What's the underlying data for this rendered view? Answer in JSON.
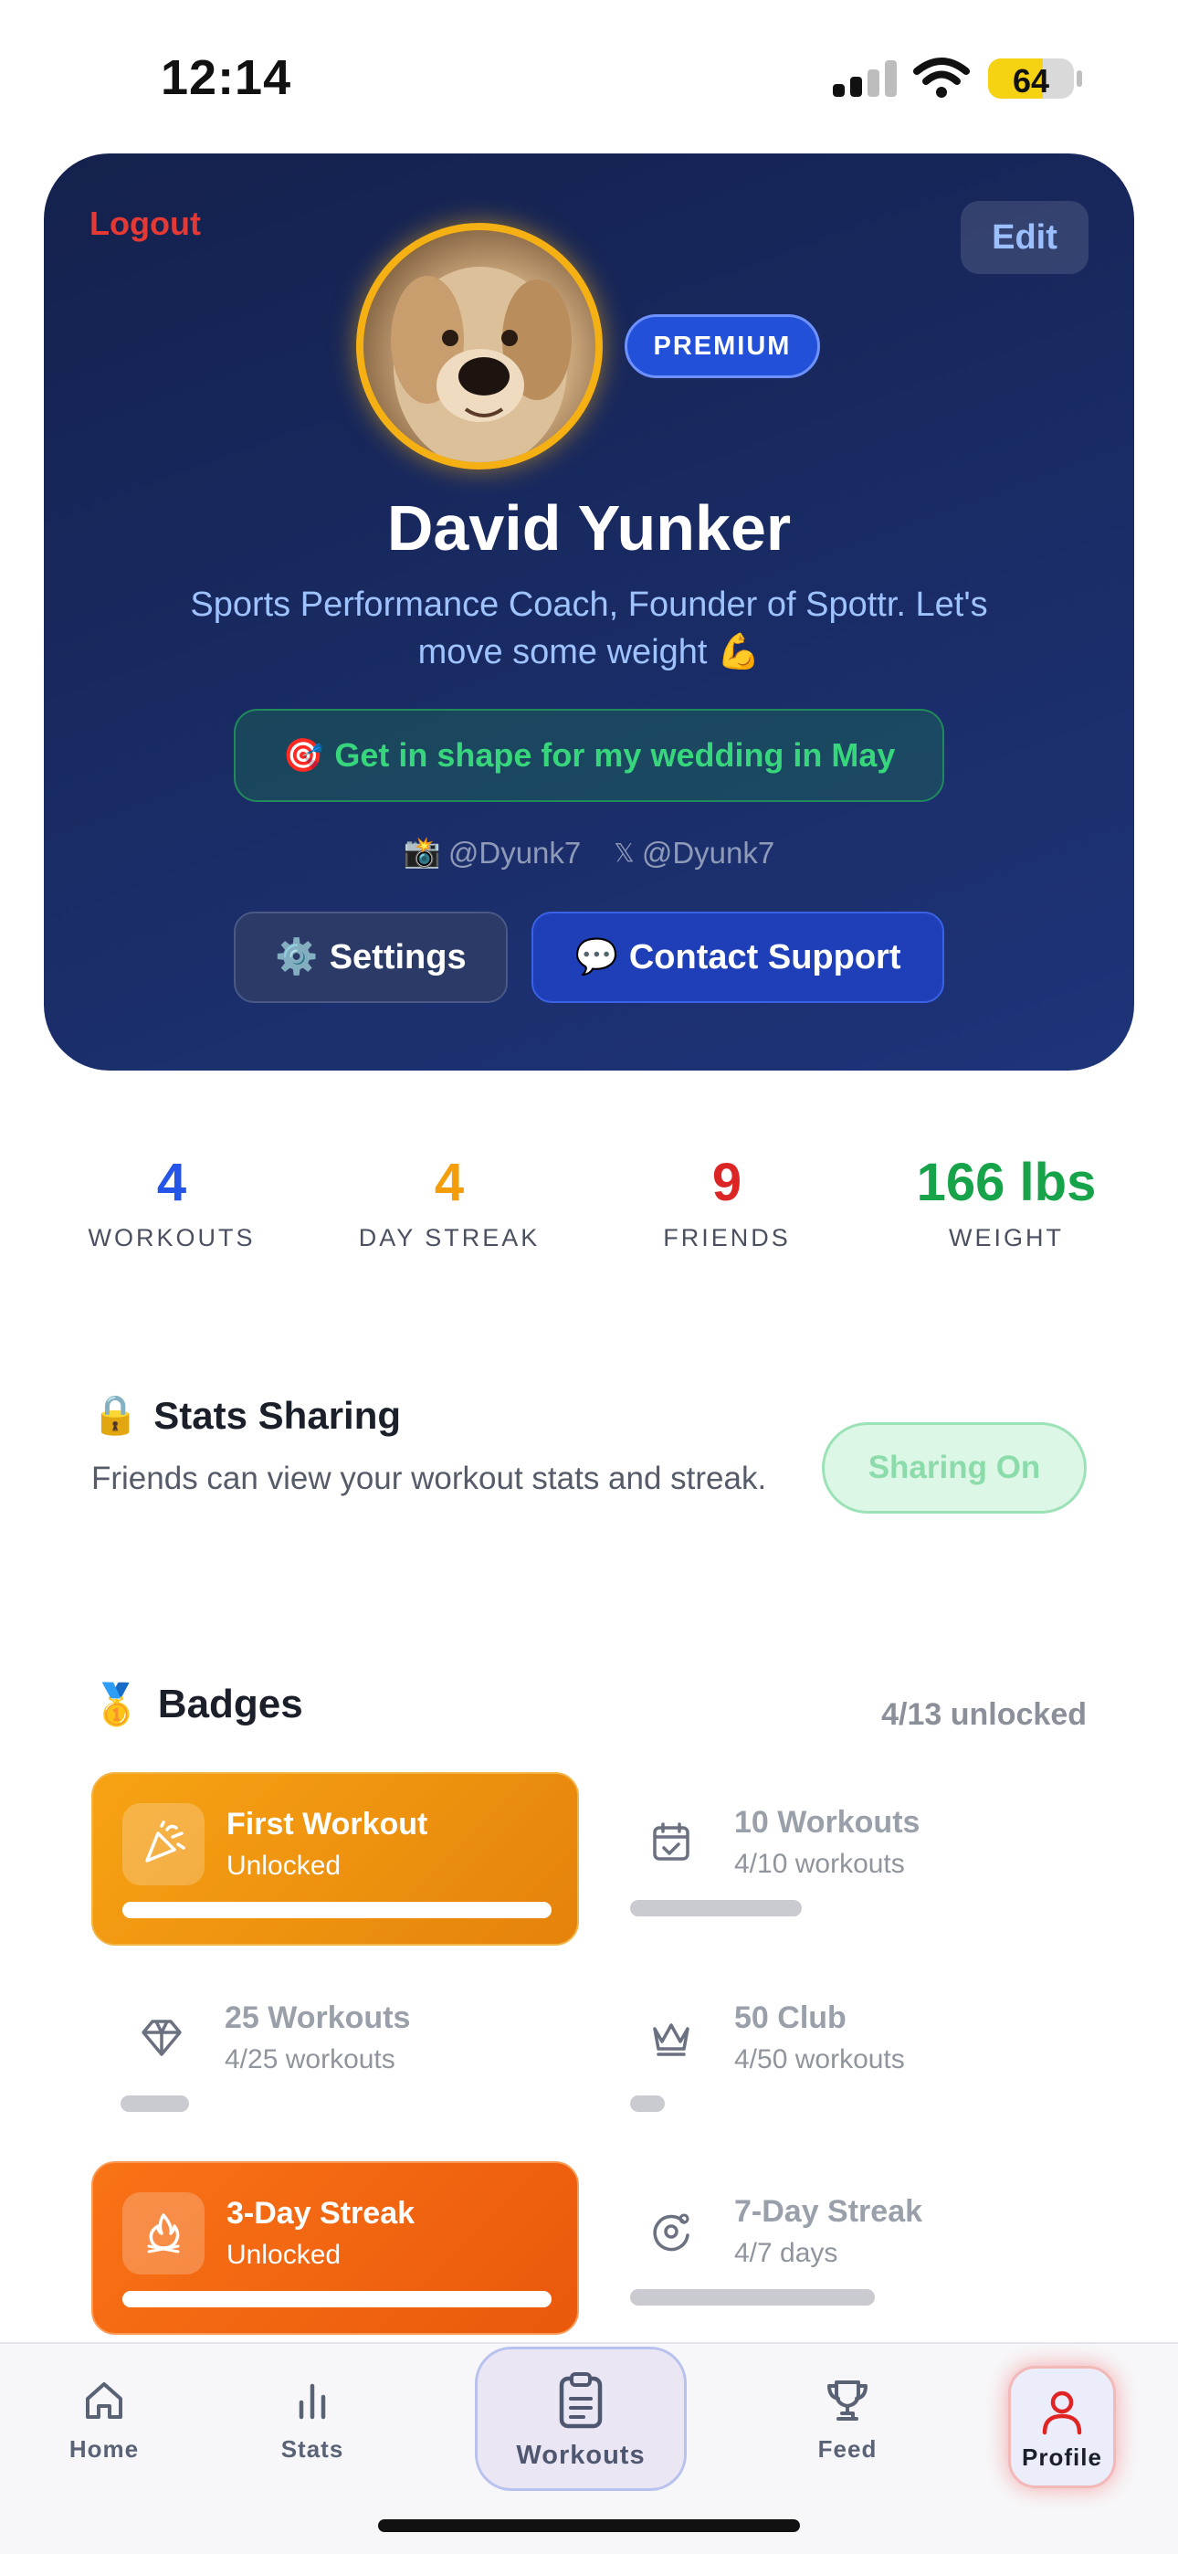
{
  "status_bar": {
    "time": "12:14",
    "battery": "64",
    "battery_level": 0.64
  },
  "profile": {
    "logout_label": "Logout",
    "edit_label": "Edit",
    "premium_badge": "PREMIUM",
    "name": "David Yunker",
    "bio": "Sports Performance Coach, Founder of Spottr. Let's move some weight 💪",
    "goal_icon": "🎯",
    "goal": "Get in shape for my wedding in May",
    "instagram_icon": "📸",
    "instagram": "@Dyunk7",
    "x_icon": "𝕏",
    "x_handle": "@Dyunk7",
    "settings_icon": "⚙️",
    "settings_label": "Settings",
    "support_icon": "💬",
    "support_label": "Contact Support"
  },
  "stats": [
    {
      "value": "4",
      "label": "WORKOUTS",
      "color": "#2454e8"
    },
    {
      "value": "4",
      "label": "DAY STREAK",
      "color": "#f59e0b"
    },
    {
      "value": "9",
      "label": "FRIENDS",
      "color": "#dc2626"
    },
    {
      "value": "166 lbs",
      "label": "WEIGHT",
      "color": "#16a34a"
    }
  ],
  "sharing": {
    "icon": "🔒",
    "title": "Stats Sharing",
    "description": "Friends can view your workout stats and streak.",
    "toggle_label": "Sharing On"
  },
  "badges": {
    "icon": "🥇",
    "title": "Badges",
    "count": "4/13 unlocked",
    "items": [
      {
        "title": "First Workout",
        "subtitle": "Unlocked",
        "unlocked": true,
        "icon": "party-popper-icon",
        "progress": 1.0
      },
      {
        "title": "10 Workouts",
        "subtitle": "4/10 workouts",
        "unlocked": false,
        "icon": "calendar-check-icon",
        "progress": 0.4
      },
      {
        "title": "25 Workouts",
        "subtitle": "4/25 workouts",
        "unlocked": false,
        "icon": "diamond-icon",
        "progress": 0.16
      },
      {
        "title": "50 Club",
        "subtitle": "4/50 workouts",
        "unlocked": false,
        "icon": "crown-icon",
        "progress": 0.08
      },
      {
        "title": "3-Day Streak",
        "subtitle": "Unlocked",
        "unlocked": true,
        "icon": "flame-icon",
        "progress": 1.0
      },
      {
        "title": "7-Day Streak",
        "subtitle": "4/7 days",
        "unlocked": false,
        "icon": "orbit-icon",
        "progress": 0.57
      }
    ]
  },
  "tabs": [
    {
      "label": "Home",
      "icon": "home-icon"
    },
    {
      "label": "Stats",
      "icon": "stats-icon"
    },
    {
      "label": "Workouts",
      "icon": "clipboard-icon"
    },
    {
      "label": "Feed",
      "icon": "trophy-icon"
    },
    {
      "label": "Profile",
      "icon": "person-icon",
      "active": true
    }
  ]
}
